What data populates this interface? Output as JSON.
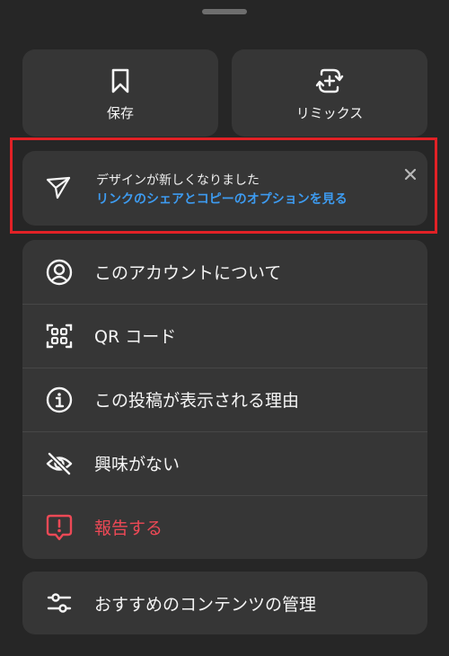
{
  "top_actions": {
    "save": {
      "label": "保存",
      "icon": "bookmark-icon"
    },
    "remix": {
      "label": "リミックス",
      "icon": "remix-icon"
    }
  },
  "notice": {
    "title": "デザインが新しくなりました",
    "link": "リンクのシェアとコピーのオプションを見る",
    "icon": "send-icon",
    "close_icon": "close-icon",
    "highlight_color": "#e12126",
    "link_color": "#3d9bf0"
  },
  "menu": {
    "items": [
      {
        "label": "このアカウントについて",
        "icon": "user-circle-icon"
      },
      {
        "label": "QR コード",
        "icon": "qr-code-icon"
      },
      {
        "label": "この投稿が表示される理由",
        "icon": "info-icon"
      },
      {
        "label": "興味がない",
        "icon": "eye-off-icon"
      },
      {
        "label": "報告する",
        "icon": "report-icon",
        "color": "#ed4956"
      }
    ]
  },
  "bottom": {
    "label": "おすすめのコンテンツの管理",
    "icon": "sliders-icon"
  }
}
